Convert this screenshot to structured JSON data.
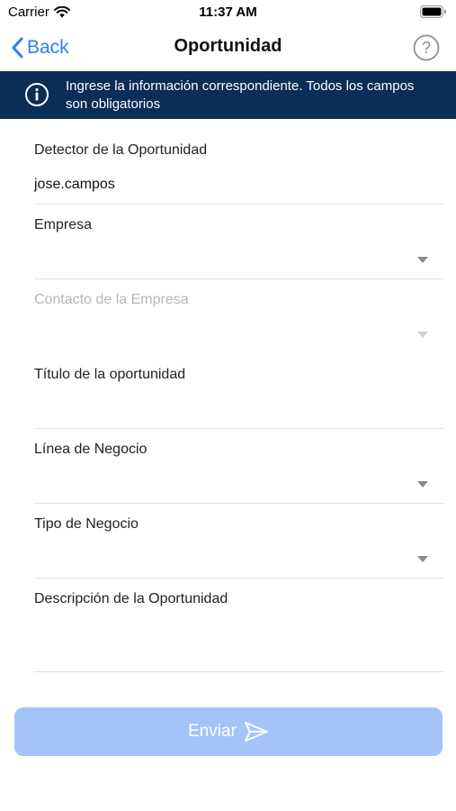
{
  "status_bar": {
    "carrier": "Carrier",
    "time": "11:37 AM"
  },
  "nav": {
    "back_label": "Back",
    "title": "Oportunidad"
  },
  "banner": {
    "text": "Ingrese la información correspondiente. Todos los campos son obligatorios"
  },
  "form": {
    "detector": {
      "label": "Detector de la Oportunidad",
      "value": "jose.campos"
    },
    "empresa": {
      "label": "Empresa",
      "value": ""
    },
    "contacto": {
      "label": "Contacto de la Empresa",
      "value": ""
    },
    "titulo": {
      "label": "Título de la oportunidad",
      "value": ""
    },
    "linea": {
      "label": "Línea de Negocio",
      "value": ""
    },
    "tipo": {
      "label": "Tipo de Negocio",
      "value": ""
    },
    "descripcion": {
      "label": "Descripción de la Oportunidad",
      "value": ""
    }
  },
  "submit": {
    "label": "Enviar"
  },
  "colors": {
    "accent": "#2f7cf6",
    "banner_bg": "#0c2d57",
    "submit_bg": "#a4c4f7"
  }
}
